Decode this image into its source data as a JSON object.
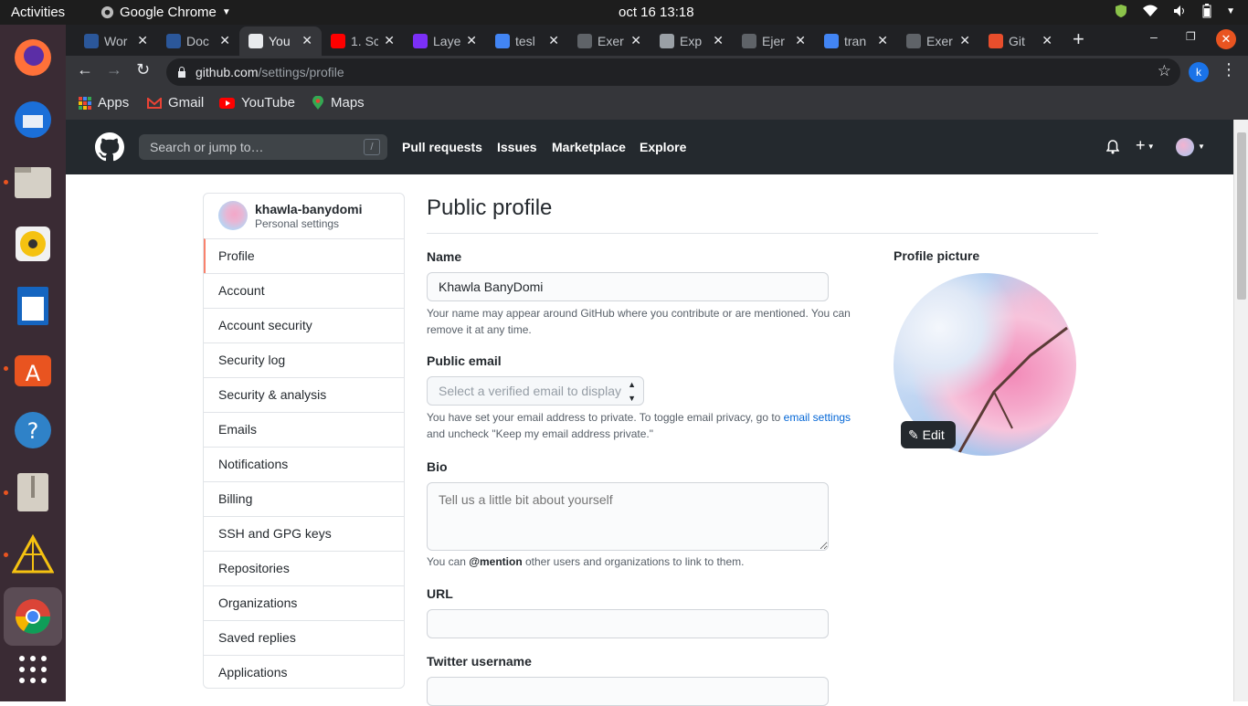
{
  "os": {
    "activities": "Activities",
    "app_name": "Google Chrome",
    "clock": "oct 16  13:18"
  },
  "tabs": [
    {
      "label": "Wor",
      "color": "#2b579a"
    },
    {
      "label": "Doc",
      "color": "#2b579a"
    },
    {
      "label": "You",
      "color": "#e8eaed",
      "active": true
    },
    {
      "label": "1. Sc",
      "color": "#ff0000"
    },
    {
      "label": "Laye",
      "color": "#7b2ff7"
    },
    {
      "label": "tesl",
      "color": "#4285f4"
    },
    {
      "label": "Exer",
      "color": "#5f6368"
    },
    {
      "label": "Exp",
      "color": "#9aa0a6"
    },
    {
      "label": "Ejer",
      "color": "#5f6368"
    },
    {
      "label": "tran",
      "color": "#4285f4"
    },
    {
      "label": "Exer",
      "color": "#5f6368"
    },
    {
      "label": "Git",
      "color": "#e84e2c"
    }
  ],
  "address": {
    "host": "github.com",
    "path": "/settings/profile",
    "avatar_letter": "k"
  },
  "bookmarks": [
    "Apps",
    "Gmail",
    "YouTube",
    "Maps"
  ],
  "header": {
    "search_placeholder": "Search or jump to…",
    "search_key": "/",
    "nav": [
      "Pull requests",
      "Issues",
      "Marketplace",
      "Explore"
    ]
  },
  "sidebar": {
    "username": "khawla-banydomi",
    "subtitle": "Personal settings",
    "items": [
      "Profile",
      "Account",
      "Account security",
      "Security log",
      "Security & analysis",
      "Emails",
      "Notifications",
      "Billing",
      "SSH and GPG keys",
      "Repositories",
      "Organizations",
      "Saved replies",
      "Applications"
    ]
  },
  "profile": {
    "title": "Public profile",
    "name_label": "Name",
    "name_value": "Khawla BanyDomi",
    "name_note": "Your name may appear around GitHub where you contribute or are mentioned. You can remove it at any time.",
    "email_label": "Public email",
    "email_select": "Select a verified email to display",
    "email_note_1": "You have set your email address to private. To toggle email privacy, go to",
    "email_link": "email settings",
    "email_note_2": "and uncheck \"Keep my email address private.\"",
    "bio_label": "Bio",
    "bio_placeholder": "Tell us a little bit about yourself",
    "bio_note_1": "You can",
    "bio_mention": "@mention",
    "bio_note_2": "other users and organizations to link to them.",
    "url_label": "URL",
    "twitter_label": "Twitter username",
    "picture_label": "Profile picture",
    "edit_label": "Edit"
  }
}
